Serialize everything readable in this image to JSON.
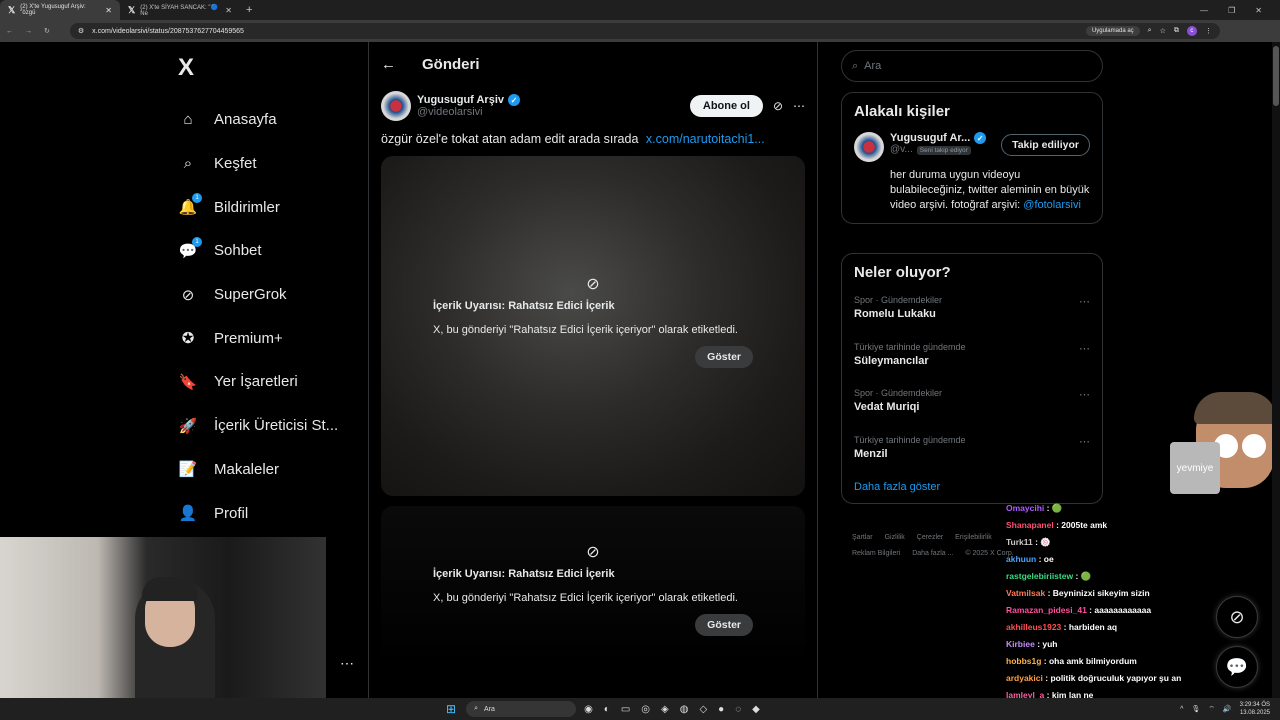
{
  "browser": {
    "tabs": [
      {
        "label": "(2) X'te Yugusuguf Arşiv: \"özgü",
        "active": true
      },
      {
        "label": "(2) X'te SİYAH SANCAK: \"🔵 Ne",
        "active": false
      }
    ],
    "url": "x.com/videolarsivi/status/2087537627704459565",
    "open_in_app": "Uygulamada aç",
    "profile_initial": "c"
  },
  "nav": {
    "logo": "X",
    "items": [
      {
        "label": "Anasayfa",
        "icon": "home-icon",
        "glyph": "⌂",
        "badge": ""
      },
      {
        "label": "Keşfet",
        "icon": "search-icon",
        "glyph": "⌕",
        "badge": ""
      },
      {
        "label": "Bildirimler",
        "icon": "bell-icon",
        "glyph": "🔔",
        "badge": "1"
      },
      {
        "label": "Sohbet",
        "icon": "chat-icon",
        "glyph": "💬",
        "badge": "1"
      },
      {
        "label": "SuperGrok",
        "icon": "grok-icon",
        "glyph": "⊘",
        "badge": ""
      },
      {
        "label": "Premium+",
        "icon": "premium-icon",
        "glyph": "✪",
        "badge": ""
      },
      {
        "label": "Yer İşaretleri",
        "icon": "bookmark-icon",
        "glyph": "🔖",
        "badge": ""
      },
      {
        "label": "İçerik Üreticisi St...",
        "icon": "rocket-icon",
        "glyph": "🚀",
        "badge": ""
      },
      {
        "label": "Makaleler",
        "icon": "article-icon",
        "glyph": "📝",
        "badge": ""
      },
      {
        "label": "Profil",
        "icon": "profile-icon",
        "glyph": "👤",
        "badge": ""
      }
    ]
  },
  "post": {
    "header_title": "Gönderi",
    "author_name": "Yugusuguf Arşiv",
    "author_handle": "@videolarsivi",
    "subscribe_label": "Abone ol",
    "text": "özgür özel'e tokat atan adam edit arada sırada",
    "link": "x.com/narutoitachi1...",
    "warning_title": "İçerik Uyarısı: Rahatsız Edici İçerik",
    "warning_desc": "X, bu gönderiyi \"Rahatsız Edici İçerik içeriyor\" olarak etiketledi.",
    "show_label": "Göster"
  },
  "sidebar": {
    "search_placeholder": "Ara",
    "related_title": "Alakalı kişiler",
    "related_name": "Yugusuguf Ar...",
    "related_handle": "@v...",
    "follows_you": "Seni takip ediyor",
    "following_label": "Takip ediliyor",
    "bio": "her duruma uygun videoyu bulabileceğiniz, twitter aleminin en büyük video arşivi. fotoğraf arşivi:",
    "bio_mention": "@fotolarsivi",
    "trends_title": "Neler oluyor?",
    "trends": [
      {
        "meta": "Spor · Gündemdekiler",
        "name": "Romelu Lukaku"
      },
      {
        "meta": "Türkiye tarihinde gündemde",
        "name": "Süleymancılar"
      },
      {
        "meta": "Spor · Gündemdekiler",
        "name": "Vedat Muriqi"
      },
      {
        "meta": "Türkiye tarihinde gündemde",
        "name": "Menzil"
      }
    ],
    "show_more": "Daha fazla göster",
    "footer": [
      "Şartlar",
      "Gizlilik",
      "Çerezler",
      "Erişilebilirlik",
      "Reklam Bilgileri",
      "Daha fazla ...",
      "© 2025 X Corp."
    ]
  },
  "chat": {
    "messages": [
      {
        "user": "Omaycihi",
        "msg": "🟢",
        "color": "#b05cff"
      },
      {
        "user": "Shanapanel",
        "msg": "2005te amk",
        "color": "#ff4f70"
      },
      {
        "user": "Turk11",
        "msg": "🍥",
        "color": "#c9c9c9"
      },
      {
        "user": "akhuun",
        "msg": "oe",
        "color": "#4aa3ff"
      },
      {
        "user": "rastgelebiriistew",
        "msg": "🟢",
        "color": "#3ddc84"
      },
      {
        "user": "Vatmilsak",
        "msg": "Beyninizxi sikeyim sizin",
        "color": "#ff7a59"
      },
      {
        "user": "Ramazan_pidesi_41",
        "msg": "aaaaaaaaaaaa",
        "color": "#ff4fa0"
      },
      {
        "user": "akhilleus1923",
        "msg": "harbiden aq",
        "color": "#ff4f4f"
      },
      {
        "user": "Kirbiee",
        "msg": "yuh",
        "color": "#c78bff"
      },
      {
        "user": "hobbs1g",
        "msg": "oha amk bilmiyordum",
        "color": "#ffb347"
      },
      {
        "user": "ardyakici",
        "msg": "politik doğruculuk yapıyor şu an",
        "color": "#ff9f43"
      },
      {
        "user": "lamleyl_a",
        "msg": "kim lan ne",
        "color": "#ff5fa2"
      }
    ],
    "mascot_label": "yevmiye"
  },
  "taskbar": {
    "search": "Ara",
    "time": "3:29:34 ÖS",
    "date": "13.08.2025"
  }
}
